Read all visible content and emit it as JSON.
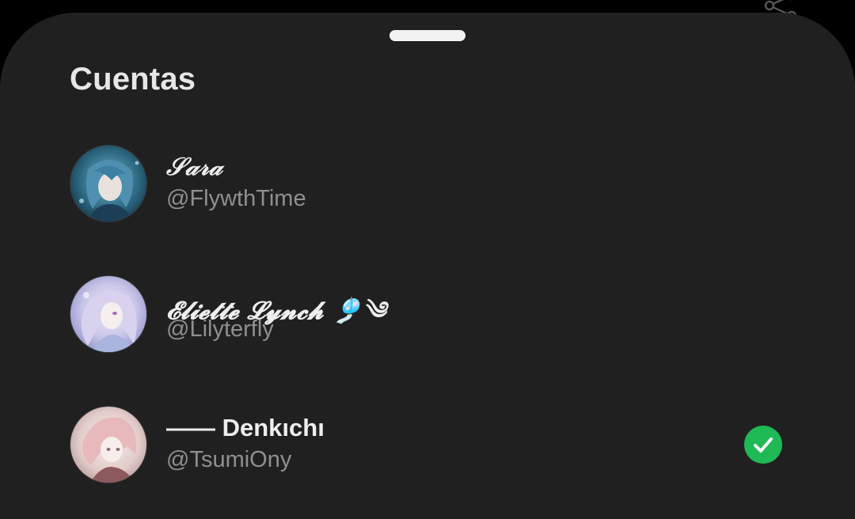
{
  "sheet": {
    "title": "Cuentas"
  },
  "accounts": [
    {
      "display_name": "𝒮𝒶𝓇𝒶",
      "handle": "@FlywthTime",
      "avatar_icon": "anime-avatar-blue-hair",
      "selected": false
    },
    {
      "display_name": "𝓔𝓵𝓲𝓮𝓽𝓽𝓮 𝓛𝔂𝓷𝓬𝓱 🎐༄",
      "handle": "@Lilyterfly",
      "avatar_icon": "anime-avatar-lavender-hair",
      "selected": false
    },
    {
      "display_name": "—— Denkıchı",
      "handle": "@TsumiOny",
      "avatar_icon": "anime-avatar-pink-hair",
      "selected": true
    }
  ],
  "icons": {
    "share": "share-icon",
    "selected_check": "check-circle-icon"
  },
  "colors": {
    "background": "#000000",
    "sheet": "#202020",
    "title": "#e7e7e7",
    "handle_text": "#8f8f8f",
    "check": "#1fb955"
  }
}
